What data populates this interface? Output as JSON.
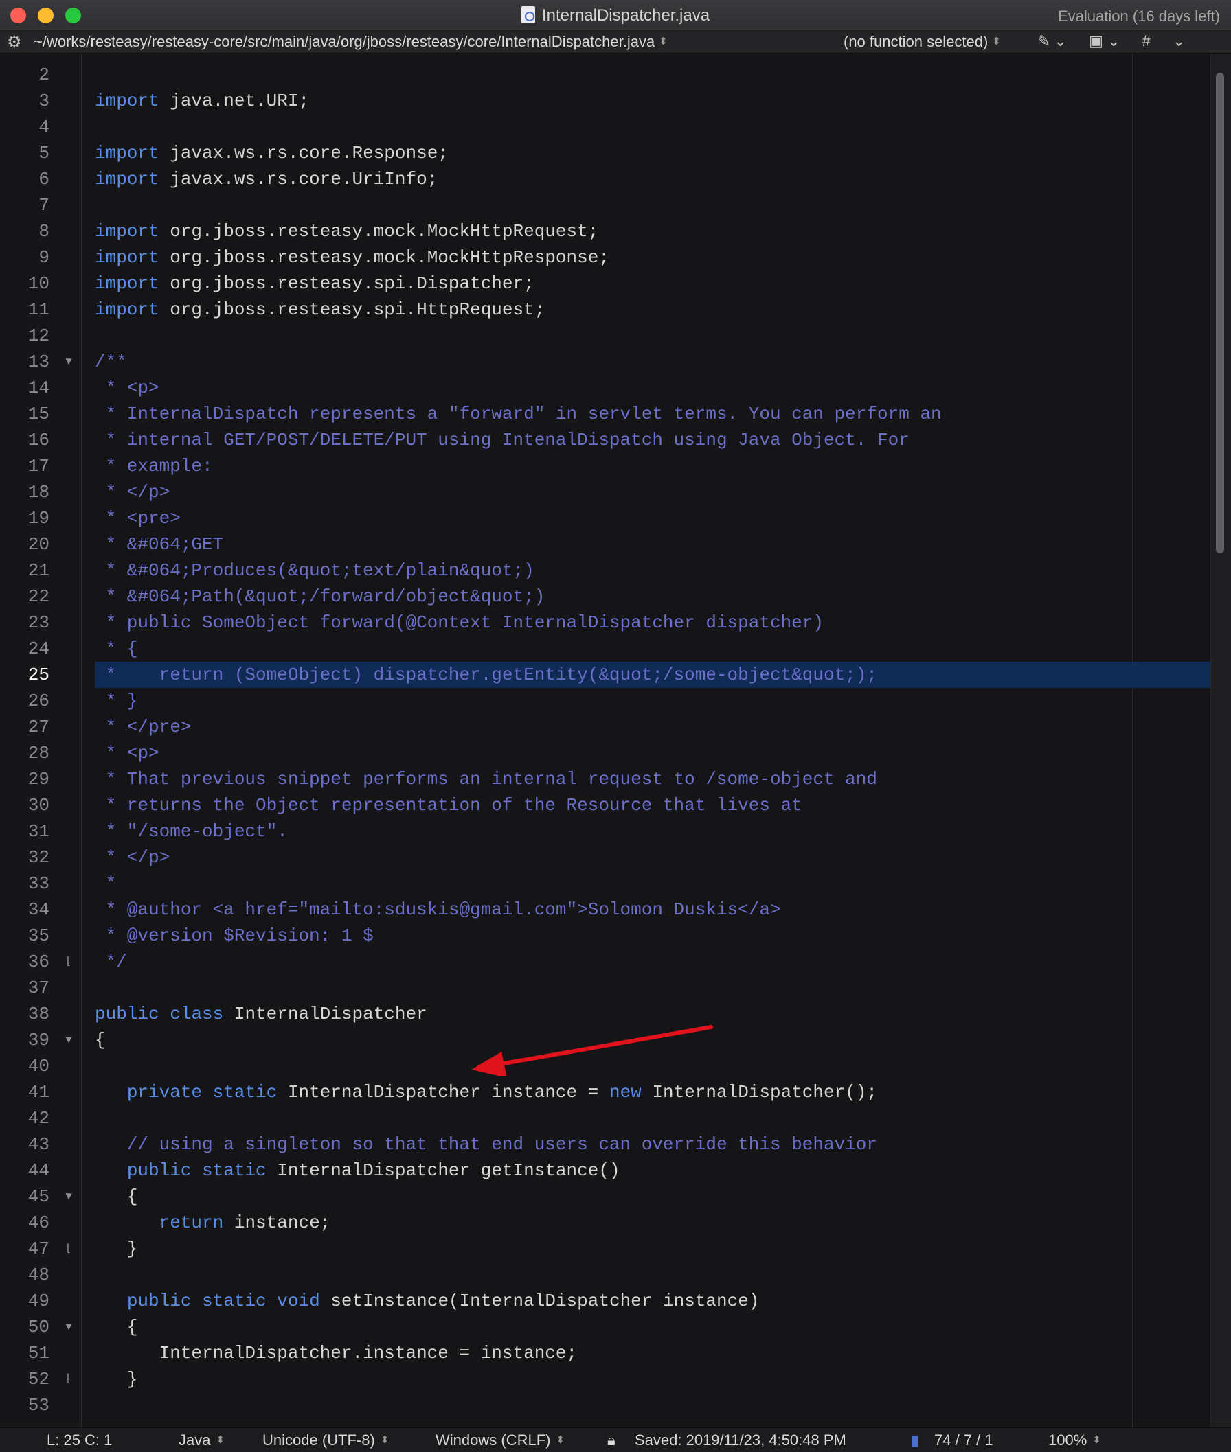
{
  "window": {
    "title": "InternalDispatcher.java",
    "evaluation": "Evaluation (16 days left)"
  },
  "navbar": {
    "path": "~/works/resteasy/resteasy-core/src/main/java/org/jboss/resteasy/core/InternalDispatcher.java",
    "function_popup": "(no function selected)",
    "tools": [
      "pencil-icon",
      "doc-icon",
      "#"
    ]
  },
  "editor": {
    "current_line": "25",
    "lines": [
      {
        "n": "2",
        "parts": []
      },
      {
        "n": "3",
        "parts": [
          {
            "t": "import",
            "c": "kw"
          },
          {
            "t": " java.net.URI;"
          }
        ]
      },
      {
        "n": "4",
        "parts": []
      },
      {
        "n": "5",
        "parts": [
          {
            "t": "import",
            "c": "kw"
          },
          {
            "t": " javax.ws.rs.core.Response;"
          }
        ]
      },
      {
        "n": "6",
        "parts": [
          {
            "t": "import",
            "c": "kw"
          },
          {
            "t": " javax.ws.rs.core.UriInfo;"
          }
        ]
      },
      {
        "n": "7",
        "parts": []
      },
      {
        "n": "8",
        "parts": [
          {
            "t": "import",
            "c": "kw"
          },
          {
            "t": " org.jboss.resteasy.mock.MockHttpRequest;"
          }
        ]
      },
      {
        "n": "9",
        "parts": [
          {
            "t": "import",
            "c": "kw"
          },
          {
            "t": " org.jboss.resteasy.mock.MockHttpResponse;"
          }
        ]
      },
      {
        "n": "10",
        "parts": [
          {
            "t": "import",
            "c": "kw"
          },
          {
            "t": " org.jboss.resteasy.spi.Dispatcher;"
          }
        ]
      },
      {
        "n": "11",
        "parts": [
          {
            "t": "import",
            "c": "kw"
          },
          {
            "t": " org.jboss.resteasy.spi.HttpRequest;"
          }
        ]
      },
      {
        "n": "12",
        "parts": []
      },
      {
        "n": "13",
        "fold": "open",
        "parts": [
          {
            "t": "/**",
            "c": "cm"
          }
        ]
      },
      {
        "n": "14",
        "parts": [
          {
            "t": " * <p>",
            "c": "cm"
          }
        ]
      },
      {
        "n": "15",
        "parts": [
          {
            "t": " * InternalDispatch represents a \"forward\" in servlet terms. You can perform an",
            "c": "cm"
          }
        ]
      },
      {
        "n": "16",
        "parts": [
          {
            "t": " * internal GET/POST/DELETE/PUT using IntenalDispatch using Java Object. For",
            "c": "cm"
          }
        ]
      },
      {
        "n": "17",
        "parts": [
          {
            "t": " * example:",
            "c": "cm"
          }
        ]
      },
      {
        "n": "18",
        "parts": [
          {
            "t": " * </p>",
            "c": "cm"
          }
        ]
      },
      {
        "n": "19",
        "parts": [
          {
            "t": " * <pre>",
            "c": "cm"
          }
        ]
      },
      {
        "n": "20",
        "parts": [
          {
            "t": " * &#064;GET",
            "c": "cm"
          }
        ]
      },
      {
        "n": "21",
        "parts": [
          {
            "t": " * &#064;Produces(&quot;text/plain&quot;)",
            "c": "cm"
          }
        ]
      },
      {
        "n": "22",
        "parts": [
          {
            "t": " * &#064;Path(&quot;/forward/object&quot;)",
            "c": "cm"
          }
        ]
      },
      {
        "n": "23",
        "parts": [
          {
            "t": " * public SomeObject forward(@Context InternalDispatcher dispatcher)",
            "c": "cm"
          }
        ]
      },
      {
        "n": "24",
        "parts": [
          {
            "t": " * {",
            "c": "cm"
          }
        ]
      },
      {
        "n": "25",
        "current": true,
        "parts": [
          {
            "t": " *    return (SomeObject) dispatcher.getEntity(&quot;/some-object&quot;);",
            "c": "cm"
          }
        ]
      },
      {
        "n": "26",
        "parts": [
          {
            "t": " * }",
            "c": "cm"
          }
        ]
      },
      {
        "n": "27",
        "parts": [
          {
            "t": " * </pre>",
            "c": "cm"
          }
        ]
      },
      {
        "n": "28",
        "parts": [
          {
            "t": " * <p>",
            "c": "cm"
          }
        ]
      },
      {
        "n": "29",
        "parts": [
          {
            "t": " * That previous snippet performs an internal request to /some-object and",
            "c": "cm"
          }
        ]
      },
      {
        "n": "30",
        "parts": [
          {
            "t": " * returns the Object representation of the Resource that lives at",
            "c": "cm"
          }
        ]
      },
      {
        "n": "31",
        "parts": [
          {
            "t": " * \"/some-object\".",
            "c": "cm"
          }
        ]
      },
      {
        "n": "32",
        "parts": [
          {
            "t": " * </p>",
            "c": "cm"
          }
        ]
      },
      {
        "n": "33",
        "parts": [
          {
            "t": " *",
            "c": "cm"
          }
        ]
      },
      {
        "n": "34",
        "parts": [
          {
            "t": " * @author <a href=\"mailto:sduskis@gmail.com\">Solomon Duskis</a>",
            "c": "cm"
          }
        ]
      },
      {
        "n": "35",
        "parts": [
          {
            "t": " * @version $Revision: 1 $",
            "c": "cm"
          }
        ]
      },
      {
        "n": "36",
        "fold": "close",
        "parts": [
          {
            "t": " */",
            "c": "cm"
          }
        ]
      },
      {
        "n": "37",
        "parts": []
      },
      {
        "n": "38",
        "parts": [
          {
            "t": "public",
            "c": "kw"
          },
          {
            "t": " "
          },
          {
            "t": "class",
            "c": "kw"
          },
          {
            "t": " InternalDispatcher"
          }
        ]
      },
      {
        "n": "39",
        "fold": "open",
        "parts": [
          {
            "t": "{"
          }
        ]
      },
      {
        "n": "40",
        "parts": []
      },
      {
        "n": "41",
        "parts": [
          {
            "t": "   "
          },
          {
            "t": "private",
            "c": "kw"
          },
          {
            "t": " "
          },
          {
            "t": "static",
            "c": "kw"
          },
          {
            "t": " InternalDispatcher instance = "
          },
          {
            "t": "new",
            "c": "kw"
          },
          {
            "t": " InternalDispatcher();"
          }
        ]
      },
      {
        "n": "42",
        "parts": []
      },
      {
        "n": "43",
        "parts": [
          {
            "t": "   // using a singleton so that that end users can override this behavior",
            "c": "cm"
          }
        ]
      },
      {
        "n": "44",
        "parts": [
          {
            "t": "   "
          },
          {
            "t": "public",
            "c": "kw"
          },
          {
            "t": " "
          },
          {
            "t": "static",
            "c": "kw"
          },
          {
            "t": " InternalDispatcher getInstance()"
          }
        ]
      },
      {
        "n": "45",
        "fold": "open",
        "parts": [
          {
            "t": "   {"
          }
        ]
      },
      {
        "n": "46",
        "parts": [
          {
            "t": "      "
          },
          {
            "t": "return",
            "c": "kw"
          },
          {
            "t": " instance;"
          }
        ]
      },
      {
        "n": "47",
        "fold": "close",
        "parts": [
          {
            "t": "   }"
          }
        ]
      },
      {
        "n": "48",
        "parts": []
      },
      {
        "n": "49",
        "parts": [
          {
            "t": "   "
          },
          {
            "t": "public",
            "c": "kw"
          },
          {
            "t": " "
          },
          {
            "t": "static",
            "c": "kw"
          },
          {
            "t": " "
          },
          {
            "t": "void",
            "c": "kw"
          },
          {
            "t": " setInstance(InternalDispatcher instance)"
          }
        ]
      },
      {
        "n": "50",
        "fold": "open",
        "parts": [
          {
            "t": "   {"
          }
        ]
      },
      {
        "n": "51",
        "parts": [
          {
            "t": "      InternalDispatcher.instance = instance;"
          }
        ]
      },
      {
        "n": "52",
        "fold": "close",
        "parts": [
          {
            "t": "   }"
          }
        ]
      },
      {
        "n": "53",
        "parts": []
      }
    ]
  },
  "statusbar": {
    "position": "L: 25 C: 1",
    "language": "Java",
    "encoding": "Unicode (UTF-8)",
    "line_endings": "Windows (CRLF)",
    "saved": "Saved: 2019/11/23, 4:50:48 PM",
    "doc_stats": "74 / 7 / 1",
    "zoom": "100%"
  },
  "colors": {
    "keyword": "#5a8ee6",
    "comment": "#6b6fc8",
    "text": "#d6d6d6",
    "current_line": "#0e2a55",
    "annotation_arrow": "#e0121b"
  }
}
